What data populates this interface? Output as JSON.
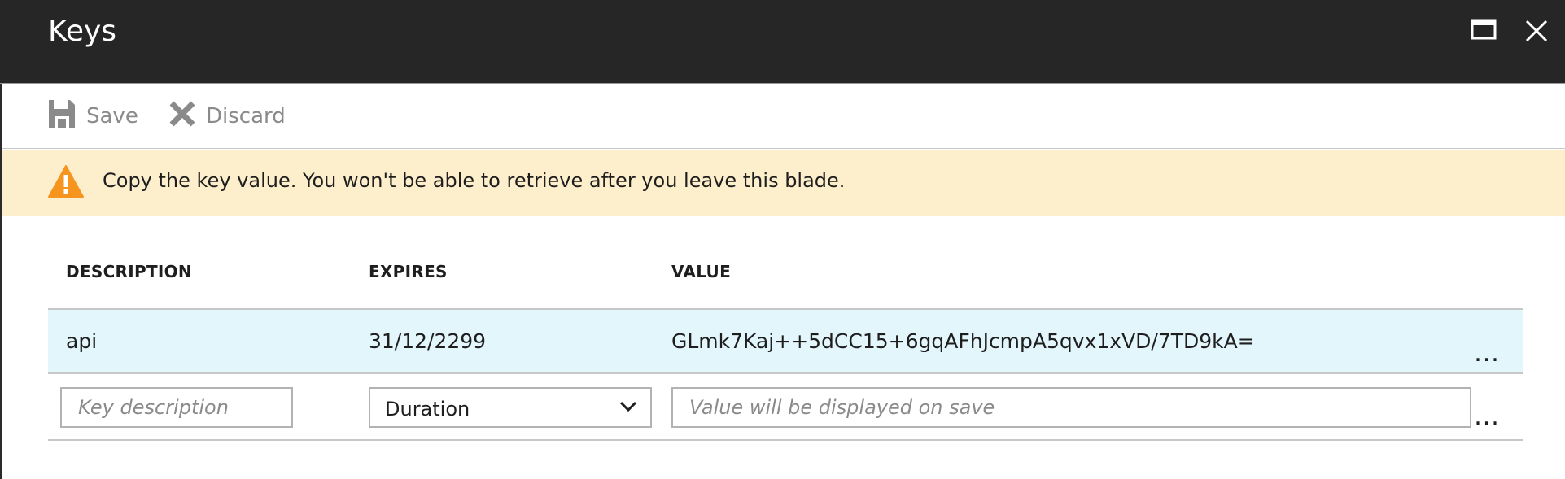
{
  "window": {
    "title": "Keys"
  },
  "toolbar": {
    "save_label": "Save",
    "discard_label": "Discard"
  },
  "banner": {
    "message": "Copy the key value. You won't be able to retrieve after you leave this blade."
  },
  "table": {
    "columns": [
      "DESCRIPTION",
      "EXPIRES",
      "VALUE"
    ],
    "rows": [
      {
        "description": "api",
        "expires": "31/12/2299",
        "value": "GLmk7Kaj++5dCC15+6gqAFhJcmpA5qvx1xVD/7TD9kA=",
        "more": "..."
      }
    ],
    "new_row": {
      "description_placeholder": "Key description",
      "duration_selected": "Duration",
      "value_placeholder": "Value will be displayed on save",
      "more": "..."
    }
  },
  "colors": {
    "titlebar": "#262626",
    "banner": "#fdeecc",
    "selected_row": "#e3f6fb",
    "warning": "#f7941d"
  }
}
